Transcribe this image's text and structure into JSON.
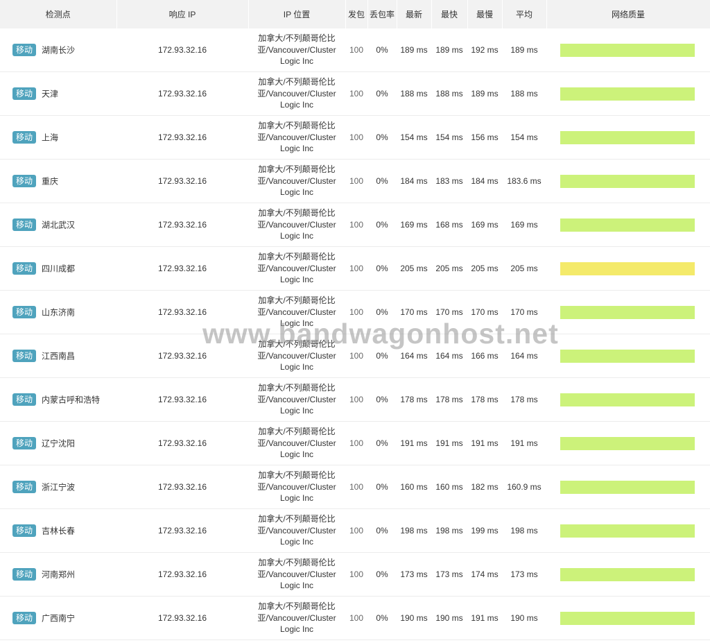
{
  "headers": {
    "node": "检测点",
    "ip": "响应 IP",
    "location": "IP 位置",
    "sent": "发包",
    "loss": "丢包率",
    "latest": "最新",
    "fastest": "最快",
    "slowest": "最慢",
    "average": "平均",
    "quality": "网络质量"
  },
  "colors": {
    "isp_badge": "#4fa3bd",
    "good": "#ccf27a",
    "warn": "#f4ea6a",
    "header_bg": "#f2f2f2"
  },
  "rows": [
    {
      "isp": "移动",
      "node": "湖南长沙",
      "ip": "172.93.32.16",
      "loc1": "加拿大/不列颠哥伦比",
      "loc2": "亚/Vancouver/Cluster",
      "loc3": "Logic Inc",
      "sent": "100",
      "loss": "0%",
      "latest": "189 ms",
      "fastest": "189 ms",
      "slowest": "192 ms",
      "average": "189 ms",
      "quality": "good"
    },
    {
      "isp": "移动",
      "node": "天津",
      "ip": "172.93.32.16",
      "loc1": "加拿大/不列颠哥伦比",
      "loc2": "亚/Vancouver/Cluster",
      "loc3": "Logic Inc",
      "sent": "100",
      "loss": "0%",
      "latest": "188 ms",
      "fastest": "188 ms",
      "slowest": "189 ms",
      "average": "188 ms",
      "quality": "good"
    },
    {
      "isp": "移动",
      "node": "上海",
      "ip": "172.93.32.16",
      "loc1": "加拿大/不列颠哥伦比",
      "loc2": "亚/Vancouver/Cluster",
      "loc3": "Logic Inc",
      "sent": "100",
      "loss": "0%",
      "latest": "154 ms",
      "fastest": "154 ms",
      "slowest": "156 ms",
      "average": "154 ms",
      "quality": "good"
    },
    {
      "isp": "移动",
      "node": "重庆",
      "ip": "172.93.32.16",
      "loc1": "加拿大/不列颠哥伦比",
      "loc2": "亚/Vancouver/Cluster",
      "loc3": "Logic Inc",
      "sent": "100",
      "loss": "0%",
      "latest": "184 ms",
      "fastest": "183 ms",
      "slowest": "184 ms",
      "average": "183.6 ms",
      "quality": "good"
    },
    {
      "isp": "移动",
      "node": "湖北武汉",
      "ip": "172.93.32.16",
      "loc1": "加拿大/不列颠哥伦比",
      "loc2": "亚/Vancouver/Cluster",
      "loc3": "Logic Inc",
      "sent": "100",
      "loss": "0%",
      "latest": "169 ms",
      "fastest": "168 ms",
      "slowest": "169 ms",
      "average": "169 ms",
      "quality": "good"
    },
    {
      "isp": "移动",
      "node": "四川成都",
      "ip": "172.93.32.16",
      "loc1": "加拿大/不列颠哥伦比",
      "loc2": "亚/Vancouver/Cluster",
      "loc3": "Logic Inc",
      "sent": "100",
      "loss": "0%",
      "latest": "205 ms",
      "fastest": "205 ms",
      "slowest": "205 ms",
      "average": "205 ms",
      "quality": "warn"
    },
    {
      "isp": "移动",
      "node": "山东济南",
      "ip": "172.93.32.16",
      "loc1": "加拿大/不列颠哥伦比",
      "loc2": "亚/Vancouver/Cluster",
      "loc3": "Logic Inc",
      "sent": "100",
      "loss": "0%",
      "latest": "170 ms",
      "fastest": "170 ms",
      "slowest": "170 ms",
      "average": "170 ms",
      "quality": "good"
    },
    {
      "isp": "移动",
      "node": "江西南昌",
      "ip": "172.93.32.16",
      "loc1": "加拿大/不列颠哥伦比",
      "loc2": "亚/Vancouver/Cluster",
      "loc3": "Logic Inc",
      "sent": "100",
      "loss": "0%",
      "latest": "164 ms",
      "fastest": "164 ms",
      "slowest": "166 ms",
      "average": "164 ms",
      "quality": "good"
    },
    {
      "isp": "移动",
      "node": "内蒙古呼和浩特",
      "ip": "172.93.32.16",
      "loc1": "加拿大/不列颠哥伦比",
      "loc2": "亚/Vancouver/Cluster",
      "loc3": "Logic Inc",
      "sent": "100",
      "loss": "0%",
      "latest": "178 ms",
      "fastest": "178 ms",
      "slowest": "178 ms",
      "average": "178 ms",
      "quality": "good"
    },
    {
      "isp": "移动",
      "node": "辽宁沈阳",
      "ip": "172.93.32.16",
      "loc1": "加拿大/不列颠哥伦比",
      "loc2": "亚/Vancouver/Cluster",
      "loc3": "Logic Inc",
      "sent": "100",
      "loss": "0%",
      "latest": "191 ms",
      "fastest": "191 ms",
      "slowest": "191 ms",
      "average": "191 ms",
      "quality": "good"
    },
    {
      "isp": "移动",
      "node": "浙江宁波",
      "ip": "172.93.32.16",
      "loc1": "加拿大/不列颠哥伦比",
      "loc2": "亚/Vancouver/Cluster",
      "loc3": "Logic Inc",
      "sent": "100",
      "loss": "0%",
      "latest": "160 ms",
      "fastest": "160 ms",
      "slowest": "182 ms",
      "average": "160.9 ms",
      "quality": "good"
    },
    {
      "isp": "移动",
      "node": "吉林长春",
      "ip": "172.93.32.16",
      "loc1": "加拿大/不列颠哥伦比",
      "loc2": "亚/Vancouver/Cluster",
      "loc3": "Logic Inc",
      "sent": "100",
      "loss": "0%",
      "latest": "198 ms",
      "fastest": "198 ms",
      "slowest": "199 ms",
      "average": "198 ms",
      "quality": "good"
    },
    {
      "isp": "移动",
      "node": "河南郑州",
      "ip": "172.93.32.16",
      "loc1": "加拿大/不列颠哥伦比",
      "loc2": "亚/Vancouver/Cluster",
      "loc3": "Logic Inc",
      "sent": "100",
      "loss": "0%",
      "latest": "173 ms",
      "fastest": "173 ms",
      "slowest": "174 ms",
      "average": "173 ms",
      "quality": "good"
    },
    {
      "isp": "移动",
      "node": "广西南宁",
      "ip": "172.93.32.16",
      "loc1": "加拿大/不列颠哥伦比",
      "loc2": "亚/Vancouver/Cluster",
      "loc3": "Logic Inc",
      "sent": "100",
      "loss": "0%",
      "latest": "190 ms",
      "fastest": "190 ms",
      "slowest": "191 ms",
      "average": "190 ms",
      "quality": "good"
    }
  ],
  "watermark": "www.bandwagonhost.net"
}
